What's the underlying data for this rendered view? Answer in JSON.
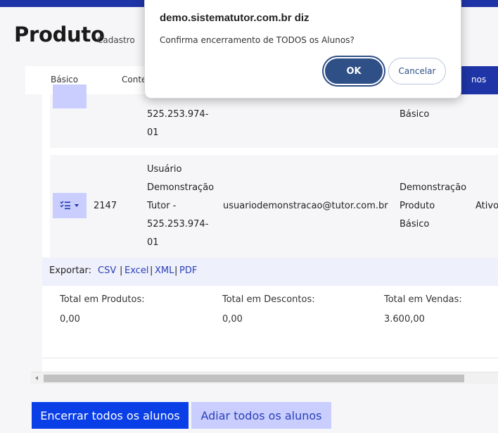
{
  "header": {
    "title": "Produto",
    "subtitle": "Cadastro"
  },
  "tabs": [
    {
      "label": "Básico"
    },
    {
      "label": "Conte"
    },
    {
      "label": "nos"
    }
  ],
  "rows": [
    {
      "name_lines": [
        "525.253.974-",
        "01"
      ],
      "product_lines": [
        "Básico"
      ]
    },
    {
      "id": "2147",
      "name_lines": [
        "Usuário",
        "Demonstração",
        "Tutor -",
        "525.253.974-",
        "01"
      ],
      "email": "usuariodemonstracao@tutor.com.br",
      "product_lines": [
        "Demonstração",
        "Produto",
        "Básico"
      ],
      "status": "Ativo"
    }
  ],
  "export": {
    "label": "Exportar:",
    "formats": [
      "CSV",
      "Excel",
      "XML",
      "PDF"
    ],
    "separator": "|"
  },
  "totals": [
    {
      "label": "Total em Produtos:",
      "value": "0,00"
    },
    {
      "label": "Total em Descontos:",
      "value": "0,00"
    },
    {
      "label": "Total em Vendas:",
      "value": "3.600,00"
    }
  ],
  "actions": {
    "close_all": "Encerrar todos os alunos",
    "postpone_all": "Adiar todos os alunos"
  },
  "dialog": {
    "title": "demo.sistematutor.com.br diz",
    "message": "Confirma encerramento de TODOS os Alunos?",
    "ok_label": "OK",
    "cancel_label": "Cancelar"
  },
  "colors": {
    "brand": "#1f34a6",
    "primary_button": "#0a3fe8",
    "secondary_button": "#c9ceff",
    "link": "#2a3fb8",
    "dialog_ok": "#2f4f87"
  },
  "icons": {
    "row_action": "list-check-icon",
    "row_caret": "caret-down-icon",
    "scroll_left": "scroll-left-arrow-icon"
  }
}
